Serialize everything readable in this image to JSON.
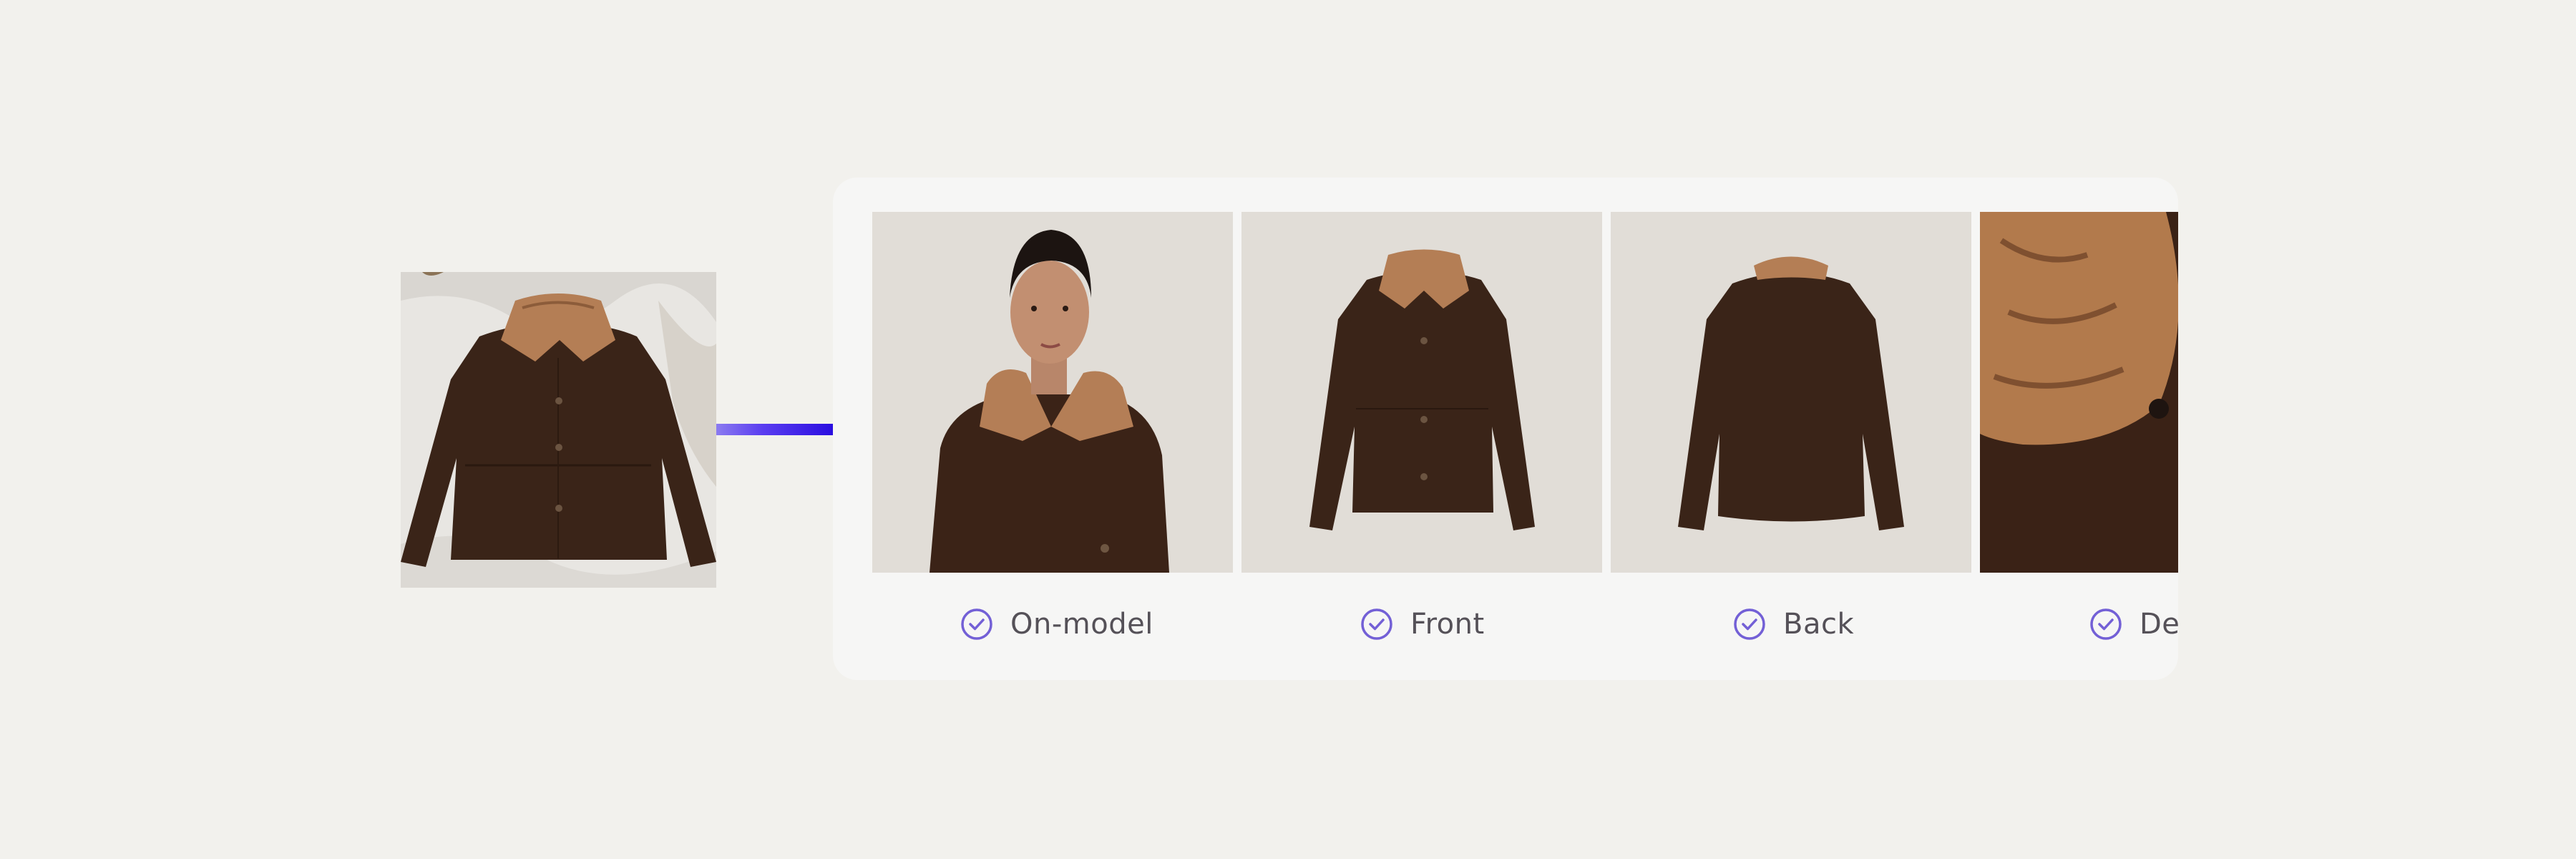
{
  "source": {
    "icon": "jacket-flatlay-photo"
  },
  "outputs": [
    {
      "label": "On-model",
      "status": "done"
    },
    {
      "label": "Front",
      "status": "done"
    },
    {
      "label": "Back",
      "status": "done"
    },
    {
      "label": "De",
      "status": "done"
    }
  ],
  "colors": {
    "accent": "#7360d6",
    "connector": "#3a1ee6",
    "background": "#f2f1ed",
    "card": "#f6f6f5"
  }
}
